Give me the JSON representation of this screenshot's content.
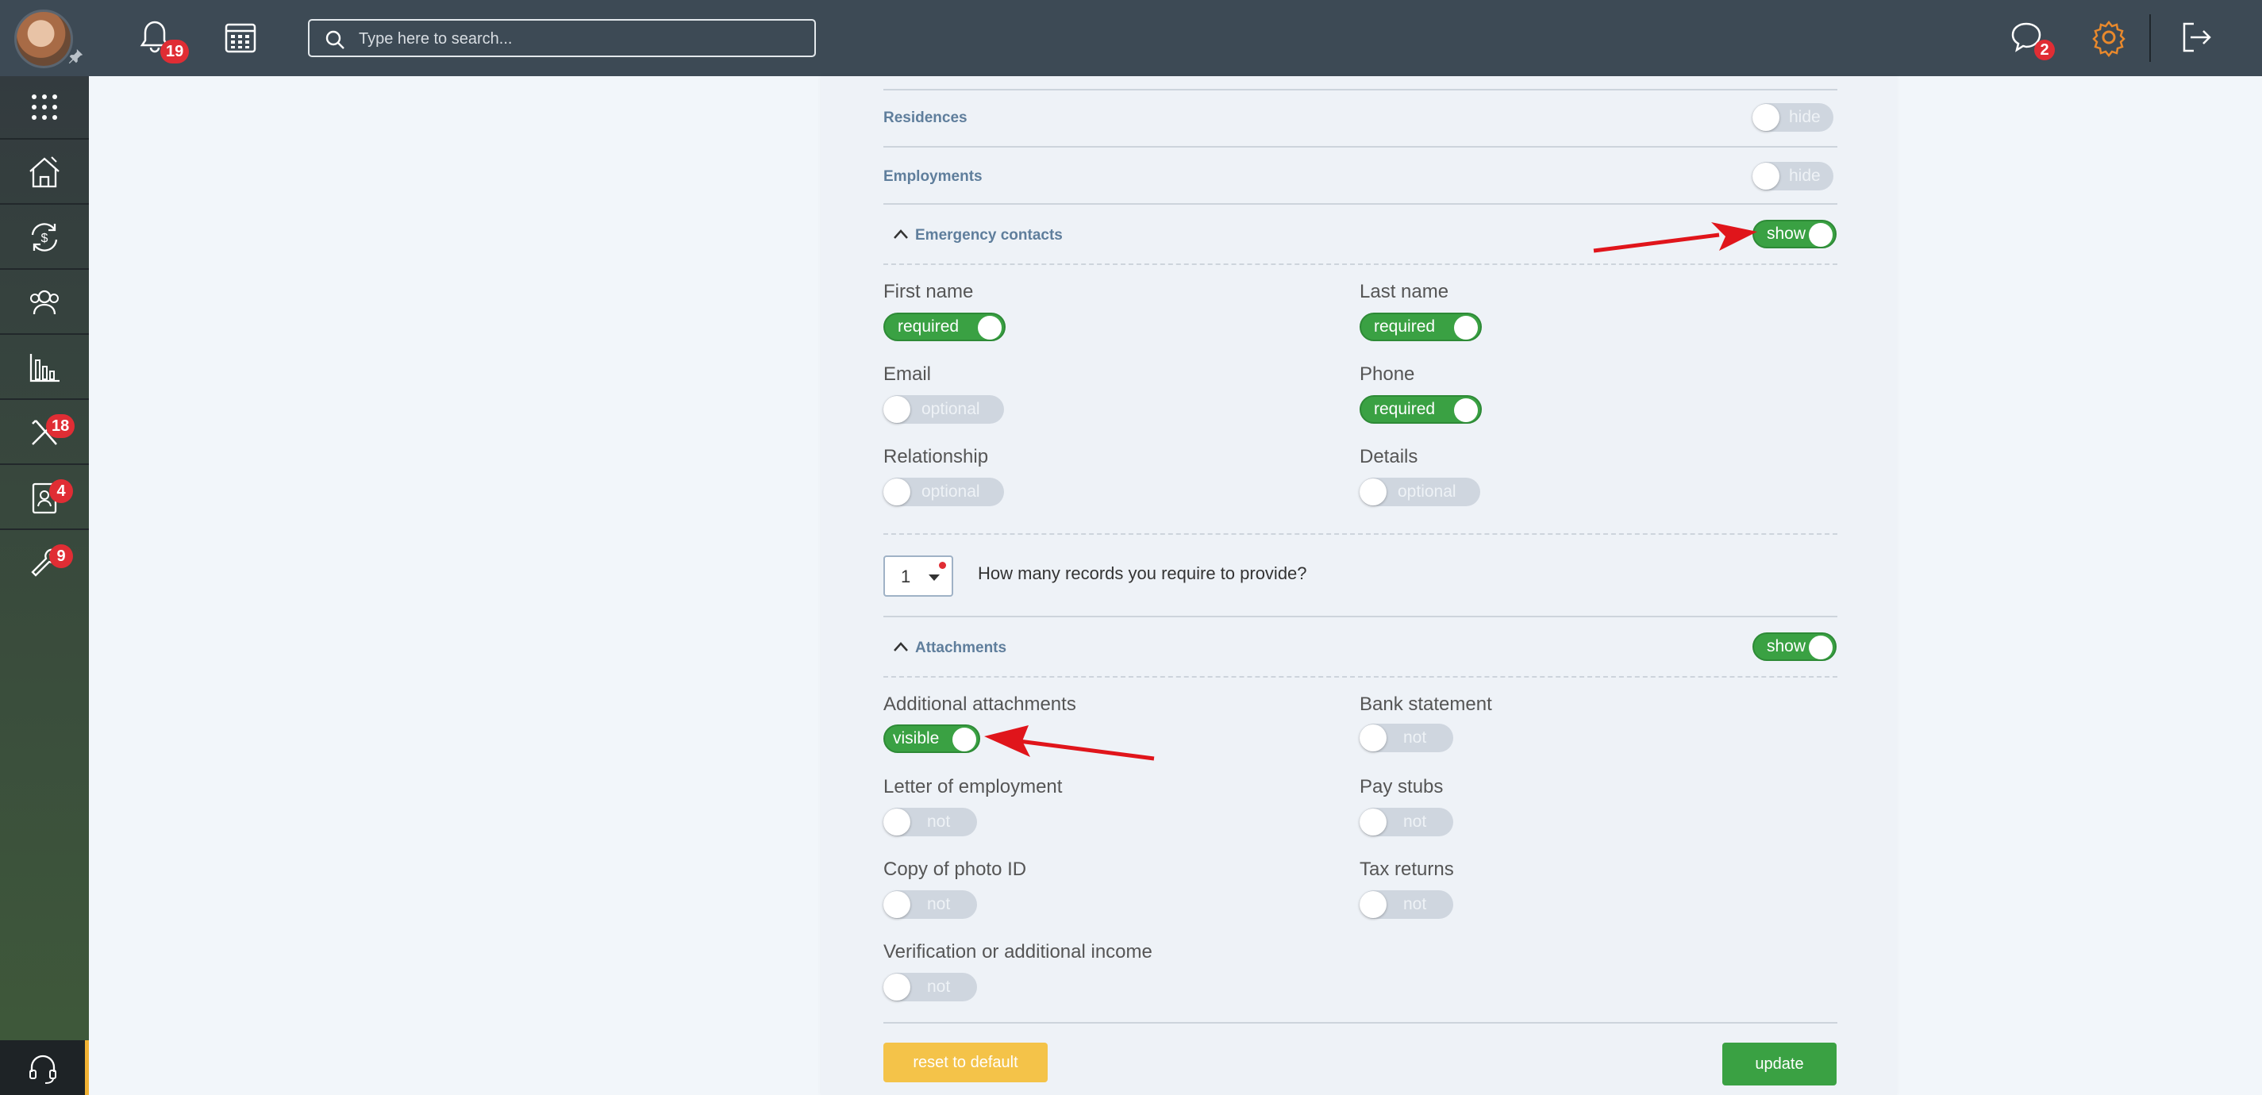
{
  "topbar": {
    "notifications_count": "19",
    "search_placeholder": "Type here to search...",
    "messages_count": "2"
  },
  "sidebar": {
    "badges": {
      "tools": "18",
      "applications": "4",
      "maintenance": "9"
    }
  },
  "settings": {
    "sections": {
      "residences": {
        "label": "Residences",
        "toggle": "hide"
      },
      "employments": {
        "label": "Employments",
        "toggle": "hide"
      },
      "emergency": {
        "label": "Emergency contacts",
        "toggle": "show"
      },
      "attachments": {
        "label": "Attachments",
        "toggle": "show"
      }
    },
    "emergency_fields": {
      "first_name": {
        "label": "First name",
        "toggle": "required"
      },
      "last_name": {
        "label": "Last name",
        "toggle": "required"
      },
      "email": {
        "label": "Email",
        "toggle": "optional"
      },
      "phone": {
        "label": "Phone",
        "toggle": "required"
      },
      "relationship": {
        "label": "Relationship",
        "toggle": "optional"
      },
      "details": {
        "label": "Details",
        "toggle": "optional"
      }
    },
    "records": {
      "value": "1",
      "question": "How many records you require to provide?"
    },
    "attachment_fields": {
      "additional": {
        "label": "Additional attachments",
        "toggle": "visible"
      },
      "bank": {
        "label": "Bank statement",
        "toggle": "not"
      },
      "letter": {
        "label": "Letter of employment",
        "toggle": "not"
      },
      "paystubs": {
        "label": "Pay stubs",
        "toggle": "not"
      },
      "photo_id": {
        "label": "Copy of photo ID",
        "toggle": "not"
      },
      "tax": {
        "label": "Tax returns",
        "toggle": "not"
      },
      "verification": {
        "label": "Verification or additional income",
        "toggle": "not"
      }
    },
    "buttons": {
      "reset": "reset to default",
      "update": "update"
    }
  },
  "colors": {
    "on": "#3aa143",
    "off": "#cfd6df",
    "badge": "#e02d34",
    "reset": "#f4c349",
    "arrow": "#e0151b"
  }
}
